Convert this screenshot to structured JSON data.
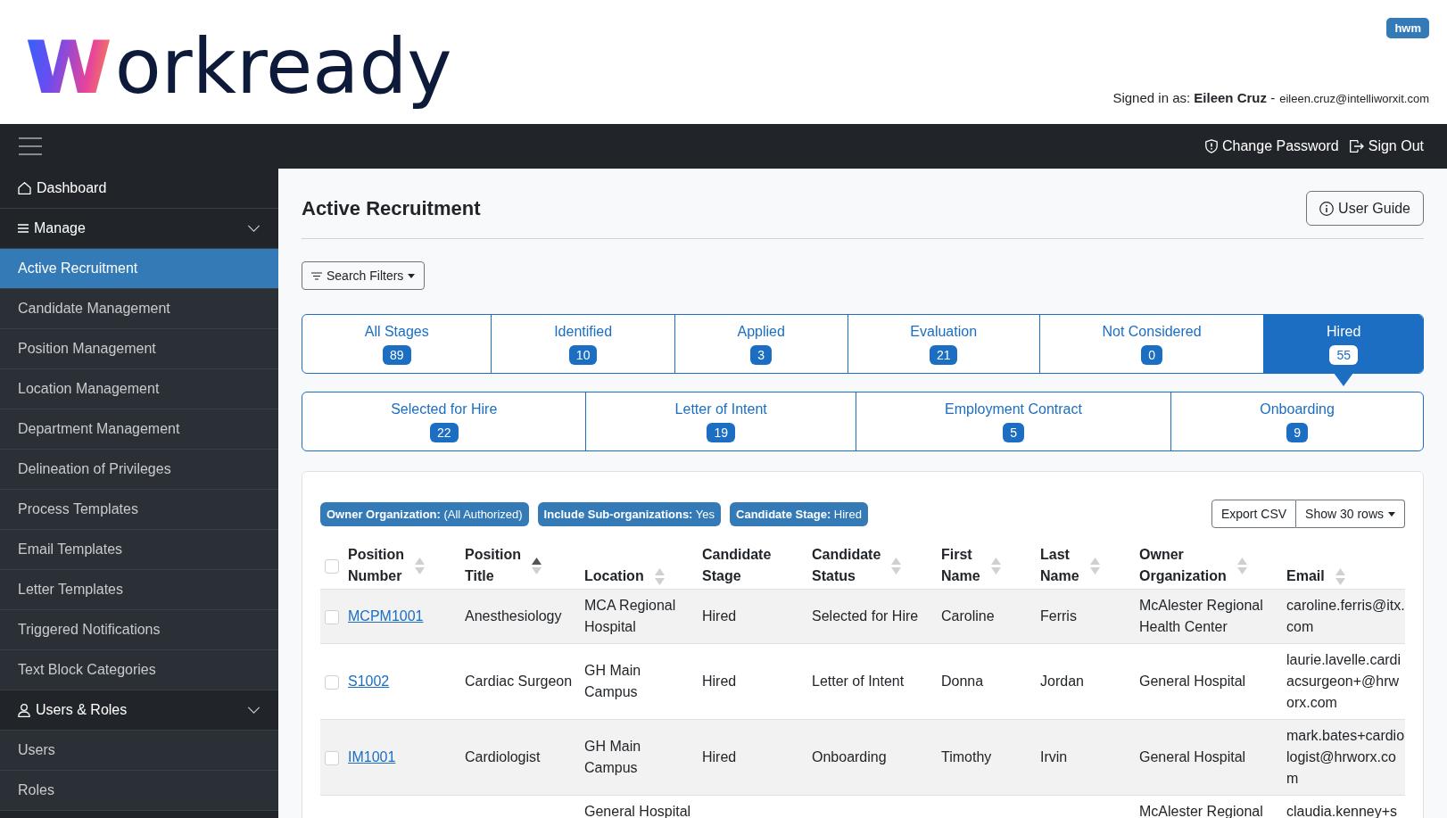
{
  "header": {
    "logo": "workready",
    "user_badge": "hwm",
    "signed_in": {
      "text": "Signed in as: **Eileen Cruz** -",
      "email": "eileen.cruz@intelliworxit.com"
    }
  },
  "navbar": {
    "actions": [
      {
        "label": "Change Password"
      },
      {
        "label": "Sign Out"
      }
    ]
  },
  "sidebar": {
    "items": [
      {
        "label": "Dashboard",
        "selected": false
      },
      {
        "label": "Manage",
        "selected": false,
        "expanded": true,
        "children": [
          {
            "label": "Active Recruitment",
            "selected": true
          },
          {
            "label": "Candidate Management",
            "selected": false
          },
          {
            "label": "Position Management",
            "selected": false
          },
          {
            "label": "Location Management",
            "selected": false
          },
          {
            "label": "Department Management",
            "selected": false
          },
          {
            "label": "Delineation of Privileges",
            "selected": false
          },
          {
            "label": "Process Templates",
            "selected": false
          },
          {
            "label": "Email Templates",
            "selected": false
          },
          {
            "label": "Letter Templates",
            "selected": false
          },
          {
            "label": "Triggered Notifications",
            "selected": false
          },
          {
            "label": "Text Block Categories",
            "selected": false
          }
        ]
      },
      {
        "label": "Users & Roles",
        "selected": false,
        "expanded": true,
        "children": [
          {
            "label": "Users",
            "selected": false
          },
          {
            "label": "Roles",
            "selected": false
          }
        ]
      }
    ]
  },
  "page": {
    "title": "Active Recruitment",
    "user_guide_button": "User Guide",
    "search_filters_button": "Search Filters"
  },
  "stages": [
    {
      "label": "All Stages",
      "count": "89",
      "selected": false
    },
    {
      "label": "Identified",
      "count": "10",
      "selected": false
    },
    {
      "label": "Applied",
      "count": "3",
      "selected": false
    },
    {
      "label": "Evaluation",
      "count": "21",
      "selected": false
    },
    {
      "label": "Not Considered",
      "count": "0",
      "selected": false
    },
    {
      "label": "Hired",
      "count": "55",
      "selected": true
    }
  ],
  "substages": [
    {
      "label": "Selected for Hire",
      "count": "22",
      "selected": false
    },
    {
      "label": "Letter of Intent",
      "count": "19",
      "selected": false
    },
    {
      "label": "Employment Contract",
      "count": "5",
      "selected": false
    },
    {
      "label": "Onboarding",
      "count": "9",
      "selected": false
    }
  ],
  "results": {
    "filter_badges": [
      "**Owner Organization:** (All Authorized)",
      "**Include Sub-organizations:** Yes",
      "**Candidate Stage:** Hired"
    ],
    "export_button": "Export CSV",
    "rows_button": "Show 30 rows",
    "table": {
      "select_all_checked": false,
      "columns": [
        {
          "label": "Position Number",
          "sorted": false,
          "kind": "link"
        },
        {
          "label": "Position Title",
          "sorted": true,
          "kind": "text"
        },
        {
          "label": "Location",
          "sorted": false,
          "kind": "text"
        },
        {
          "label": "Candidate Stage",
          "kind": "text"
        },
        {
          "label": "Candidate Status",
          "sorted": false,
          "kind": "text"
        },
        {
          "label": "First Name",
          "sorted": false,
          "kind": "text"
        },
        {
          "label": "Last Name",
          "sorted": false,
          "kind": "text"
        },
        {
          "label": "Owner Organization",
          "sorted": false,
          "kind": "text"
        },
        {
          "label": "Email",
          "sorted": false,
          "kind": "email"
        }
      ],
      "rows": [
        {
          "checked": false,
          "position_number": "MCPM1001",
          "position_title": "Anesthesiology",
          "location": "MCA Regional Hospital",
          "candidate_stage": "Hired",
          "candidate_status": "Selected for Hire",
          "first_name": "Caroline",
          "last_name": "Ferris",
          "owner_organization": "McAlester Regional Health Center",
          "email": "caroline.ferris@itx.com"
        },
        {
          "checked": false,
          "position_number": "S1002",
          "position_title": "Cardiac Surgeon",
          "location": "GH Main Campus",
          "candidate_stage": "Hired",
          "candidate_status": "Letter of Intent",
          "first_name": "Donna",
          "last_name": "Jordan",
          "owner_organization": "General Hospital",
          "email": "laurie.lavelle.cardiacsurgeon+@hrworx.com"
        },
        {
          "checked": false,
          "position_number": "IM1001",
          "position_title": "Cardiologist",
          "location": "GH Main Campus",
          "candidate_stage": "Hired",
          "candidate_status": "Onboarding",
          "first_name": "Timothy",
          "last_name": "Irvin",
          "owner_organization": "General Hospital",
          "email": "mark.bates+cardiologist@hrworx.com"
        },
        {
          "location": "General Hospital",
          "owner_organization": "McAlester Regional",
          "email": "claudia.kenney+s"
        }
      ]
    }
  }
}
